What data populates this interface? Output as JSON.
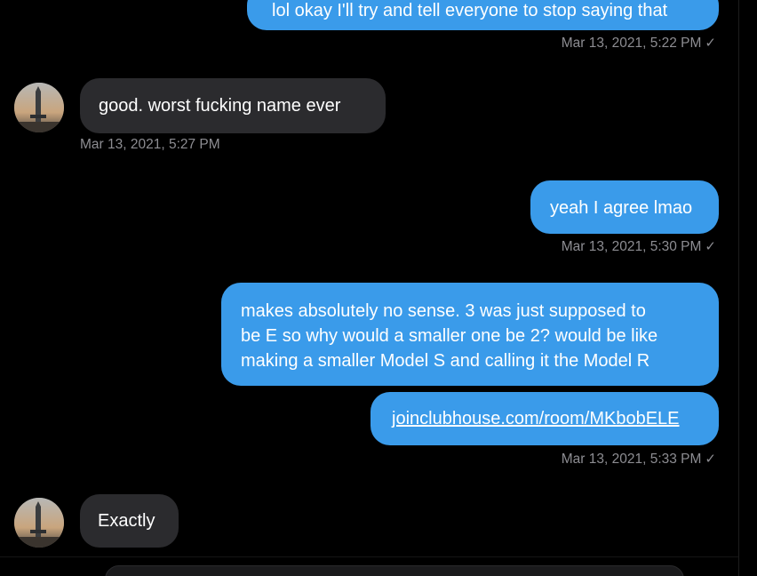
{
  "messages": [
    {
      "direction": "outgoing",
      "text": "lol okay I'll try and tell everyone to stop saying that",
      "timestamp": "Mar 13, 2021, 5:22 PM",
      "read_mark": "✓"
    },
    {
      "direction": "incoming",
      "text": "good. worst fucking name ever",
      "timestamp": "Mar 13, 2021, 5:27 PM",
      "avatar_icon": "rocket-avatar-icon"
    },
    {
      "direction": "outgoing",
      "text": "yeah I agree lmao",
      "timestamp": "Mar 13, 2021, 5:30 PM",
      "read_mark": "✓"
    },
    {
      "direction": "outgoing",
      "lines": [
        "makes absolutely no sense. 3 was just supposed to",
        "be E so why would a smaller one be 2? would be like",
        "making a smaller Model S and calling it the Model R"
      ]
    },
    {
      "direction": "outgoing",
      "link": "joinclubhouse.com/room/MKbobELE",
      "timestamp": "Mar 13, 2021, 5:33 PM",
      "read_mark": "✓"
    },
    {
      "direction": "incoming",
      "text": "Exactly",
      "avatar_icon": "rocket-avatar-icon"
    }
  ],
  "colors": {
    "outgoing_bubble": "#3a9bea",
    "incoming_bubble": "#2b2b2e",
    "background": "#000000",
    "timestamp": "#8d8d92"
  }
}
